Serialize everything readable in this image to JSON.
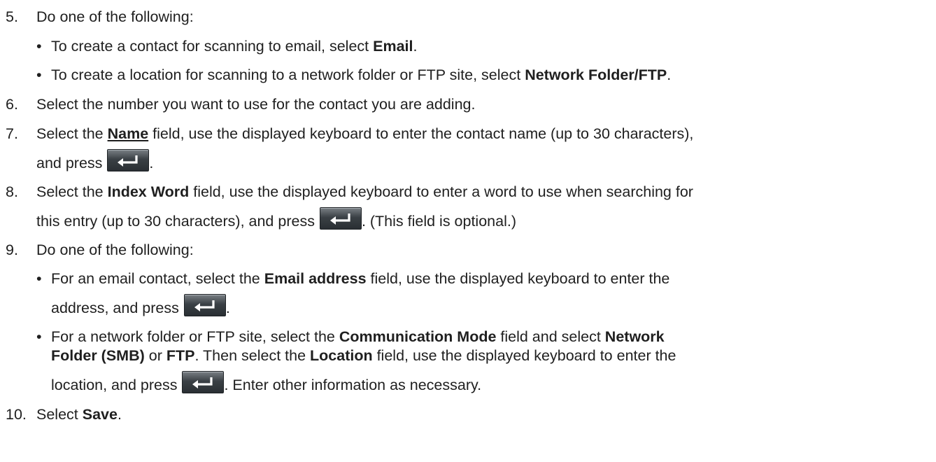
{
  "steps": [
    {
      "num": "5.",
      "text": "Do one of the following:"
    },
    {
      "num": "6.",
      "text": "Select the number you want to use for the contact you are adding."
    },
    {
      "num": "7.",
      "pre": "Select the ",
      "bold": "Name",
      "post": " field, use the displayed keyboard to enter the contact name (up to 30 characters),",
      "line2": "and press",
      "line2_end": "."
    },
    {
      "num": "8.",
      "pre": "Select the ",
      "bold": "Index Word",
      "post": " field, use the displayed keyboard to enter a word to use when searching for",
      "line2": "this entry (up to 30 characters), and press",
      "line2_end": ". (This field is optional.)"
    },
    {
      "num": "9.",
      "text": "Do one of the following:"
    },
    {
      "num": "10.",
      "pre": "Select ",
      "bold": "Save",
      "post": "."
    }
  ],
  "bullets5": [
    {
      "pre": "To create a contact for scanning to email, select ",
      "bold": "Email",
      "post": "."
    },
    {
      "pre": "To create a location for scanning to a network folder or FTP site, select ",
      "bold": "Network Folder/FTP",
      "post": "."
    }
  ],
  "bullets9": {
    "email": {
      "pre": "For an email contact, select the ",
      "bold": "Email address",
      "post": " field, use the displayed keyboard to enter the",
      "line2": "address, and press",
      "line2_end": "."
    },
    "network": {
      "pre": "For a network folder or FTP site, select the ",
      "bold1": "Communication Mode",
      "mid1": " field and select ",
      "bold2": "Network",
      "line2_bold": "Folder (SMB)",
      "line2_mid": " or ",
      "line2_bold2": "FTP",
      "line2_mid2": ". Then select the ",
      "line2_bold3": "Location",
      "line2_post": " field, use the displayed keyboard to enter the",
      "line3": "location, and press",
      "line3_end": ". Enter other information as necessary."
    }
  },
  "bullet_char": "•",
  "icon": "enter-key-icon",
  "colors": {
    "text": "#1f1f1f",
    "key_bg": "#3a4045",
    "key_arrow": "#ffffff"
  }
}
